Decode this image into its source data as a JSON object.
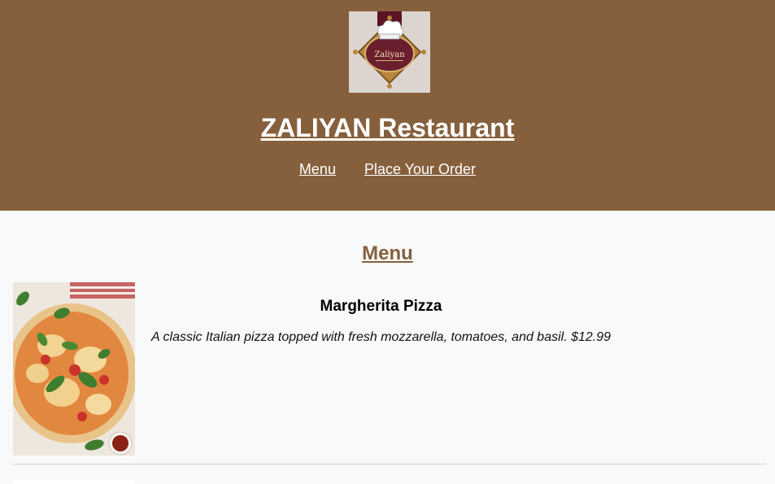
{
  "header": {
    "logo_text": "Zaliyan",
    "title": "ZALIYAN Restaurant",
    "nav": [
      {
        "label": "Menu"
      },
      {
        "label": "Place Your Order"
      }
    ]
  },
  "main": {
    "section_title": "Menu",
    "items": [
      {
        "name": "Margherita Pizza",
        "description": "A classic Italian pizza topped with fresh mozzarella, tomatoes, and basil. $12.99"
      }
    ]
  },
  "colors": {
    "header_bg": "#86603c",
    "page_bg": "#f8f9fa",
    "section_title": "#86603c"
  }
}
